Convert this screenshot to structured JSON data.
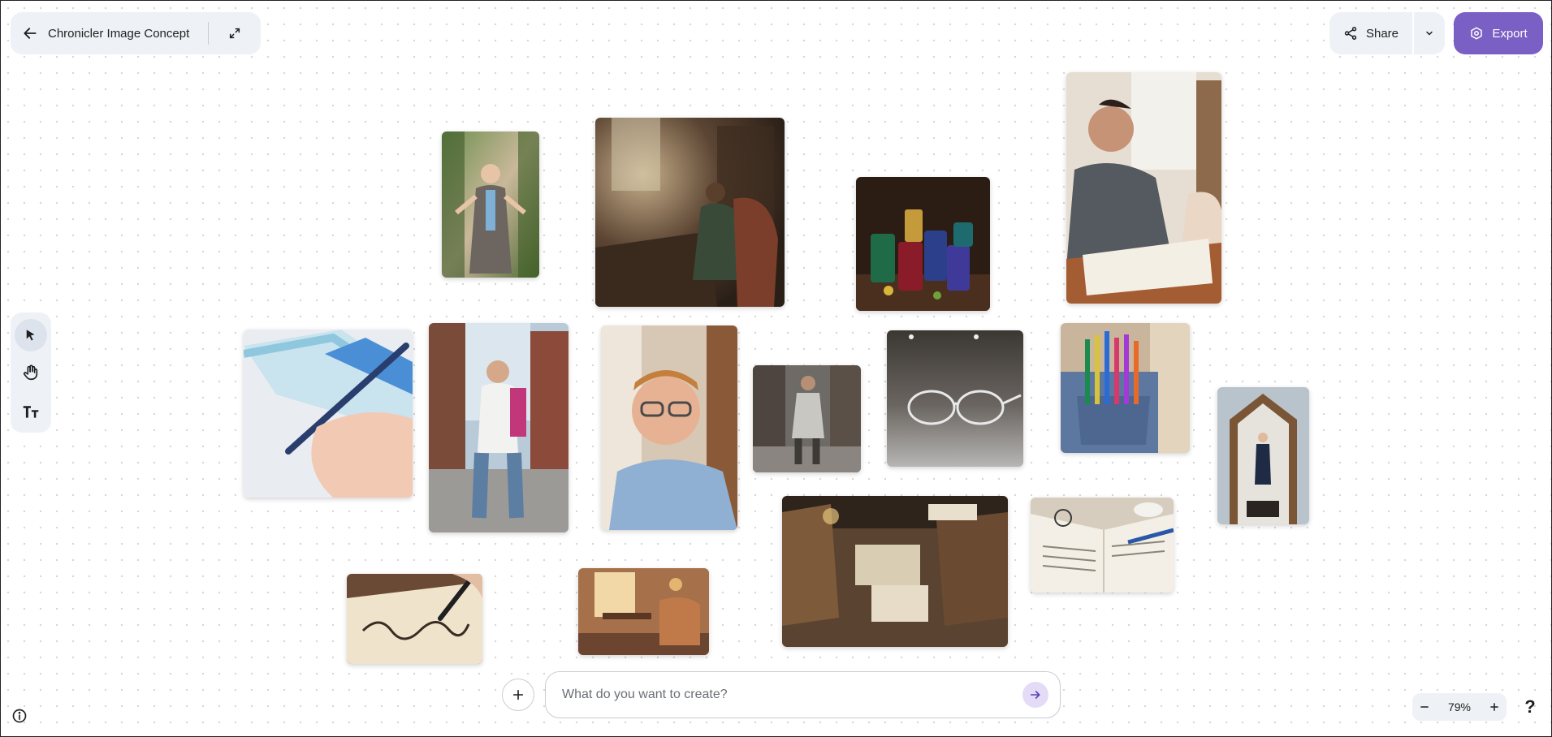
{
  "header": {
    "title": "Chronicler Image Concept",
    "share_label": "Share",
    "export_label": "Export"
  },
  "toolbar": {
    "tools": [
      "select-arrow-icon",
      "hand-icon",
      "text-icon"
    ],
    "active": "select-arrow-icon"
  },
  "canvas": {
    "images": [
      "woman-welcoming",
      "person-reading-in-study",
      "ink-bottles",
      "people-signing-document",
      "hand-writing-with-pen",
      "man-walking-city-street",
      "smiling-man-glasses",
      "man-in-alley",
      "eyeglasses-on-table",
      "pens-in-pocket",
      "woman-in-archway",
      "books-on-desk",
      "open-notebook-with-pen",
      "signature-calligraphy",
      "cozy-study-room"
    ]
  },
  "prompt": {
    "placeholder": "What do you want to create?",
    "value": ""
  },
  "zoom": {
    "level": "79%",
    "help_label": "?"
  },
  "colors": {
    "accent": "#7a5fc4",
    "panel": "#eef1f6",
    "send_bg": "#e4dcf6"
  }
}
